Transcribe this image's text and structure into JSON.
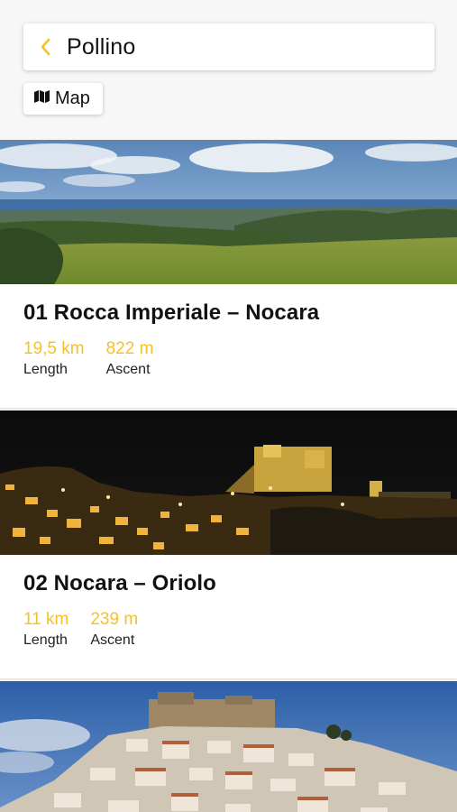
{
  "header": {
    "title": "Pollino",
    "back_icon": "chevron-left-icon",
    "accent_color": "#f5c028"
  },
  "map_button": {
    "label": "Map",
    "icon": "map-icon"
  },
  "stages": [
    {
      "title": "01 Rocca Imperiale – Nocara",
      "length_value": "19,5 km",
      "length_label": "Length",
      "ascent_value": "822 m",
      "ascent_label": "Ascent",
      "image": "coastal-landscape-photo"
    },
    {
      "title": "02 Nocara – Oriolo",
      "length_value": "11 km",
      "length_label": "Length",
      "ascent_value": "239 m",
      "ascent_label": "Ascent",
      "image": "night-castle-town-photo"
    },
    {
      "image": "hilltop-village-photo"
    }
  ]
}
